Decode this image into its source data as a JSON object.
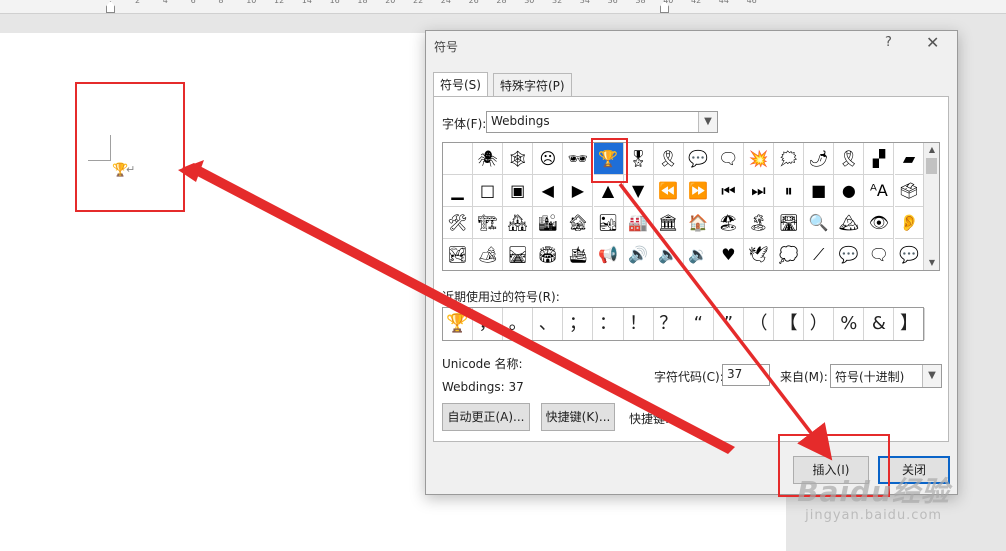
{
  "ruler": {
    "numbers": [
      "2",
      "4",
      "6",
      "8",
      "10",
      "12",
      "14",
      "16",
      "18",
      "20",
      "22",
      "24",
      "26",
      "28",
      "30",
      "32",
      "34",
      "36",
      "38",
      "40",
      "42",
      "44",
      "46"
    ]
  },
  "document": {
    "inserted_glyph": "🏆",
    "paragraph_mark": "↵"
  },
  "dialog": {
    "title": "符号",
    "help": "?",
    "close": "✕",
    "tabs": [
      {
        "label": "符号(S)",
        "active": true
      },
      {
        "label": "特殊字符(P)",
        "active": false
      }
    ],
    "font_label": "字体(F):",
    "font_value": "Webdings",
    "symbols": [
      [
        "",
        "🕷",
        "🕸",
        "☹",
        "🕶",
        "🏆",
        "🎖",
        "🎗",
        "💬",
        "🗨",
        "💥",
        "🗯",
        "🌶",
        "🎗",
        "▞",
        "▰"
      ],
      [
        "▁",
        "□",
        "▣",
        "◀",
        "▶",
        "▲",
        "▼",
        "⏪",
        "⏩",
        "⏮",
        "⏭",
        "⏸",
        "■",
        "●",
        "ᴬA",
        "🗳"
      ],
      [
        "🛠",
        "🏗",
        "🏘",
        "🏙",
        "🏚",
        "🏜",
        "🏭",
        "🏛",
        "🏠",
        "🏖",
        "🏝",
        "🛣",
        "🔍",
        "🏔",
        "👁",
        "👂"
      ],
      [
        "🏞",
        "🏕",
        "🛤",
        "🏟",
        "🛳",
        "📢",
        "🔊",
        "🔈",
        "🔉",
        "♥",
        "🕊",
        "💭",
        "⟋",
        "💬",
        "🗨",
        "💬"
      ]
    ],
    "recent_label": "近期使用过的符号(R):",
    "recent": [
      "🏆",
      "，",
      "。",
      "、",
      "；",
      "：",
      "！",
      "？",
      "“",
      "”",
      "（",
      "【",
      "）",
      "%",
      "&",
      "】"
    ],
    "unicode_label": "Unicode 名称:",
    "font_code": "Webdings: 37",
    "char_code_label": "字符代码(C):",
    "char_code_value": "37",
    "from_label": "来自(M):",
    "from_value": "符号(十进制)",
    "autocorrect_btn": "自动更正(A)...",
    "shortcut_btn": "快捷键(K)...",
    "shortcut_label": "快捷键:",
    "insert_btn": "插入(I)",
    "close_btn": "关闭"
  },
  "watermark": {
    "logo": "Baidu经验",
    "url": "jingyan.baidu.com"
  },
  "colors": {
    "annotation": "#e52b2b",
    "selection": "#1e6ed8"
  }
}
